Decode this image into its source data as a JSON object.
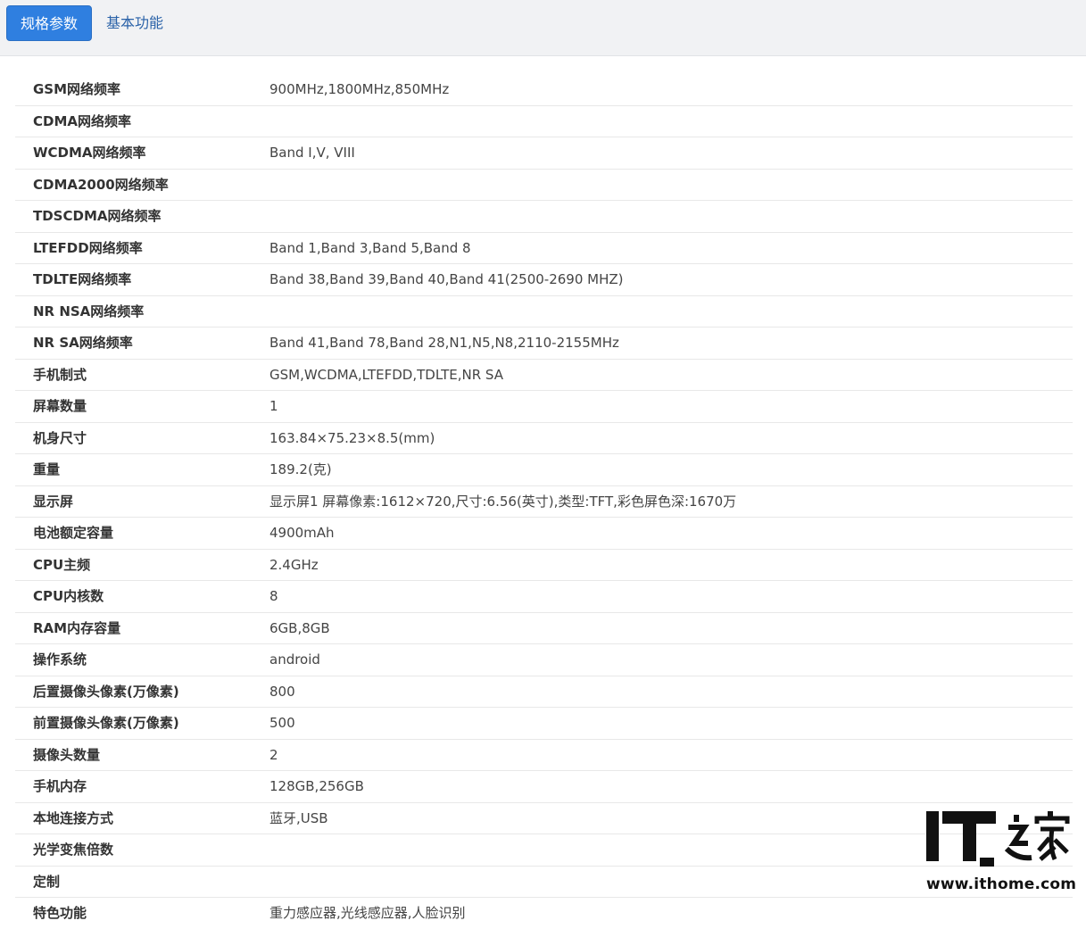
{
  "tabs": [
    {
      "label": "规格参数",
      "active": true
    },
    {
      "label": "基本功能",
      "active": false
    }
  ],
  "specs": [
    {
      "key": "GSM网络频率",
      "value": "900MHz,1800MHz,850MHz"
    },
    {
      "key": "CDMA网络频率",
      "value": ""
    },
    {
      "key": "WCDMA网络频率",
      "value": "Band Ⅰ,V, VIII"
    },
    {
      "key": "CDMA2000网络频率",
      "value": ""
    },
    {
      "key": "TDSCDMA网络频率",
      "value": ""
    },
    {
      "key": "LTEFDD网络频率",
      "value": "Band 1,Band 3,Band 5,Band 8"
    },
    {
      "key": "TDLTE网络频率",
      "value": "Band 38,Band 39,Band 40,Band 41(2500-2690 MHZ)"
    },
    {
      "key": "NR NSA网络频率",
      "value": ""
    },
    {
      "key": "NR SA网络频率",
      "value": "Band 41,Band 78,Band 28,N1,N5,N8,2110-2155MHz"
    },
    {
      "key": "手机制式",
      "value": "GSM,WCDMA,LTEFDD,TDLTE,NR SA"
    },
    {
      "key": "屏幕数量",
      "value": "1"
    },
    {
      "key": "机身尺寸",
      "value": "163.84×75.23×8.5(mm)"
    },
    {
      "key": "重量",
      "value": "189.2(克)"
    },
    {
      "key": "显示屏",
      "value": "显示屏1 屏幕像素:1612×720,尺寸:6.56(英寸),类型:TFT,彩色屏色深:1670万"
    },
    {
      "key": "电池额定容量",
      "value": "4900mAh"
    },
    {
      "key": "CPU主频",
      "value": "2.4GHz"
    },
    {
      "key": "CPU内核数",
      "value": "8"
    },
    {
      "key": "RAM内存容量",
      "value": "6GB,8GB"
    },
    {
      "key": "操作系统",
      "value": "android"
    },
    {
      "key": "后置摄像头像素(万像素)",
      "value": "800"
    },
    {
      "key": "前置摄像头像素(万像素)",
      "value": "500"
    },
    {
      "key": "摄像头数量",
      "value": "2"
    },
    {
      "key": "手机内存",
      "value": "128GB,256GB"
    },
    {
      "key": "本地连接方式",
      "value": "蓝牙,USB"
    },
    {
      "key": "光学变焦倍数",
      "value": ""
    },
    {
      "key": "定制",
      "value": ""
    },
    {
      "key": "特色功能",
      "value": "重力感应器,光线感应器,人脸识别"
    }
  ],
  "watermark": {
    "logo_text": "IT之家",
    "url": "www.ithome.com"
  },
  "colors": {
    "accent": "#2f7fe0",
    "link": "#2a62a8",
    "topbar_bg": "#f1f2f4"
  }
}
